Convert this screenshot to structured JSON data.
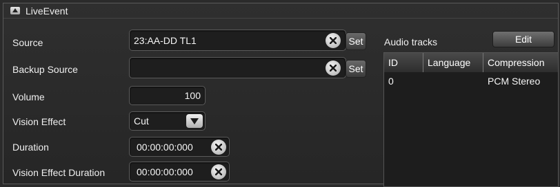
{
  "panel": {
    "title": "LiveEvent"
  },
  "form": {
    "source": {
      "label": "Source",
      "value": "23:AA-DD TL1",
      "set_label": "Set"
    },
    "backup_source": {
      "label": "Backup Source",
      "value": "",
      "set_label": "Set"
    },
    "volume": {
      "label": "Volume",
      "value": "100"
    },
    "vision_effect": {
      "label": "Vision Effect",
      "selected": "Cut"
    },
    "duration": {
      "label": "Duration",
      "value": "00:00:00:000"
    },
    "vision_effect_duration": {
      "label": "Vision Effect Duration",
      "value": "00:00:00:000"
    }
  },
  "audio_tracks": {
    "title": "Audio tracks",
    "edit_label": "Edit",
    "columns": [
      "ID",
      "Language",
      "Compression"
    ],
    "rows": [
      {
        "id": "0",
        "language": "",
        "compression": "PCM Stereo"
      }
    ]
  },
  "icons": {
    "collapse": "collapse-triangle-icon",
    "clear": "clear-x-icon",
    "dropdown": "chevron-down-icon"
  }
}
